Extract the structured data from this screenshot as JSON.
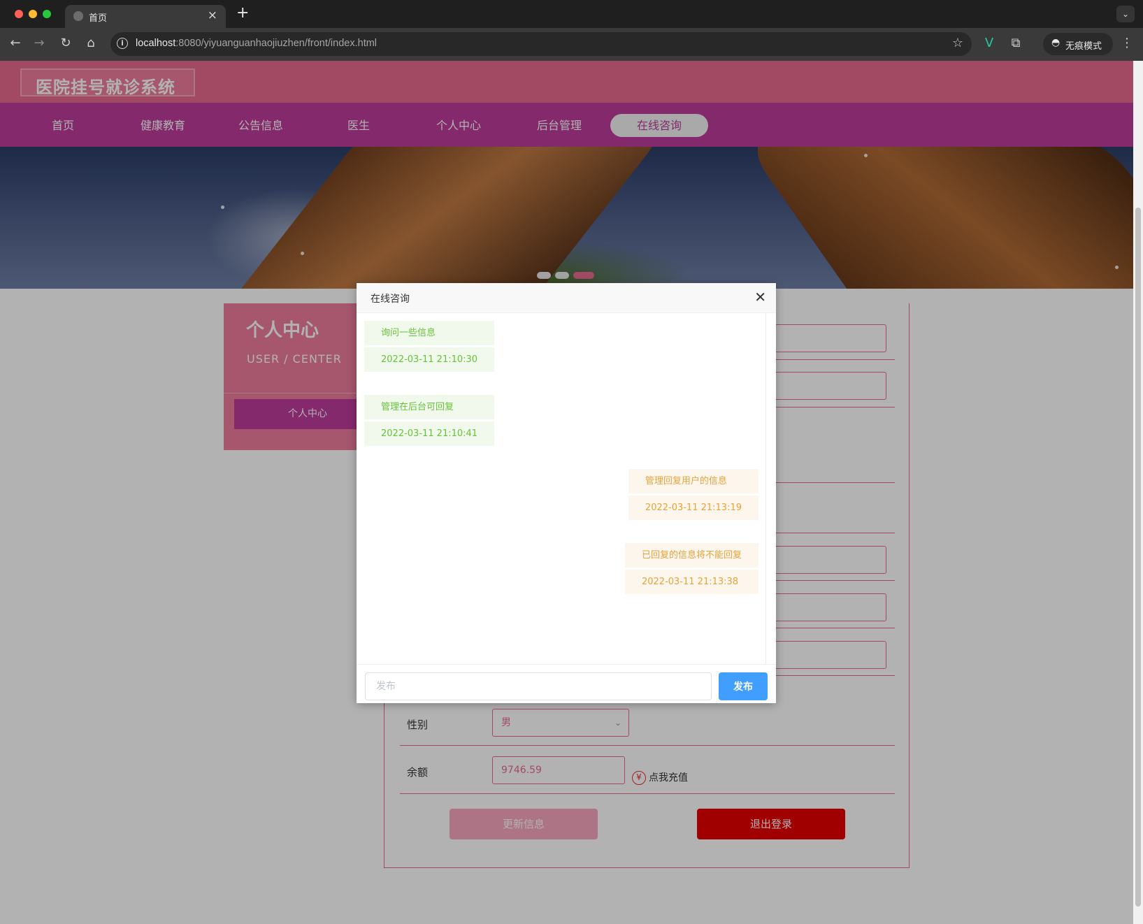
{
  "browser": {
    "tab_title": "首页",
    "tab_close": "×",
    "new_tab": "+",
    "url_host": "localhost",
    "url_rest": ":8080/yiyuanguanhaojiuzhen/front/index.html",
    "incognito_label": "无痕模式"
  },
  "site": {
    "logo": "医院挂号就诊系统",
    "nav": [
      "首页",
      "健康教育",
      "公告信息",
      "医生",
      "个人中心",
      "后台管理",
      "在线咨询"
    ],
    "active_nav": "在线咨询"
  },
  "sidebar": {
    "title": "个人中心",
    "subtitle": "USER / CENTER",
    "button": "个人中心"
  },
  "profile_form": {
    "gender_label": "性别",
    "gender_value": "男",
    "balance_label": "余额",
    "balance_value": "9746.59",
    "recharge_icon": "¥",
    "recharge_text": "点我充值",
    "update_button": "更新信息",
    "logout_button": "退出登录"
  },
  "dialog": {
    "title": "在线咨询",
    "close_icon": "close-icon",
    "messages": [
      {
        "side": "left",
        "text": "询问一些信息",
        "time": "2022-03-11 21:10:30"
      },
      {
        "side": "left",
        "text": "管理在后台可回复",
        "time": "2022-03-11 21:10:41"
      },
      {
        "side": "right",
        "text": "管理回复用户的信息",
        "time": "2022-03-11 21:13:19"
      },
      {
        "side": "right",
        "text": "已回复的信息将不能回复",
        "time": "2022-03-11 21:13:38"
      }
    ],
    "input_placeholder": "发布",
    "send_button": "发布"
  },
  "colors": {
    "header_pink": "#e96b8e",
    "nav_purple": "#bc3c9b",
    "logout_red": "#e60000",
    "send_blue": "#409eff"
  }
}
